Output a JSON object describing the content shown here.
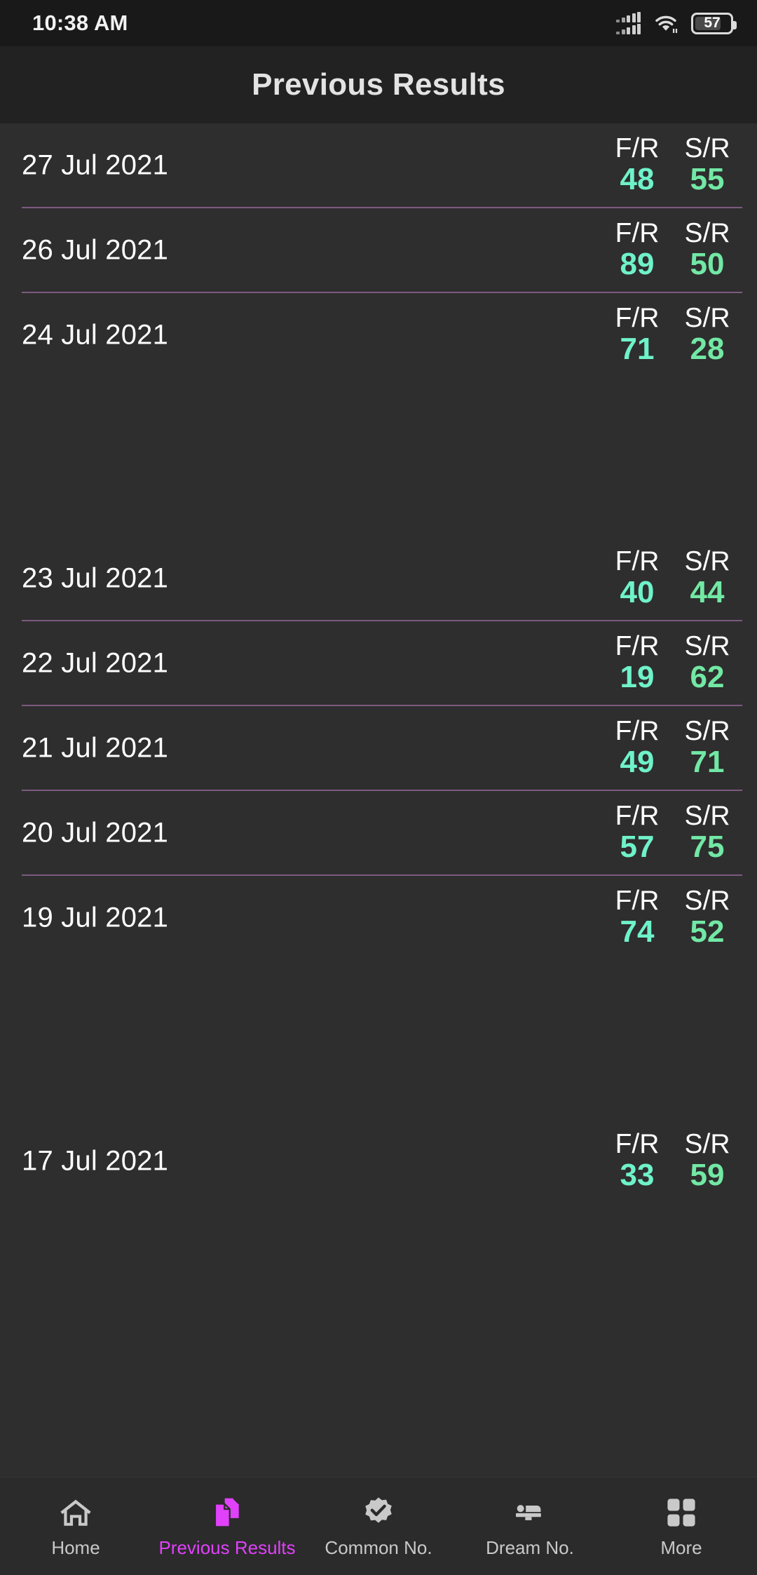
{
  "status_bar": {
    "time": "10:38 AM",
    "battery_level": "57",
    "signal_icon": "signal-bars-icon",
    "wifi_icon": "wifi-icon",
    "battery_icon": "battery-icon"
  },
  "app_bar": {
    "title": "Previous Results"
  },
  "list": {
    "column_labels": {
      "first": "F/R",
      "second": "S/R"
    },
    "rows": [
      {
        "date": "27 Jul 2021",
        "fr": "48",
        "sr": "55",
        "divider": true,
        "gap_after": false
      },
      {
        "date": "26 Jul 2021",
        "fr": "89",
        "sr": "50",
        "divider": true,
        "gap_after": false
      },
      {
        "date": "24 Jul 2021",
        "fr": "71",
        "sr": "28",
        "divider": false,
        "gap_after": true
      },
      {
        "date": "23 Jul 2021",
        "fr": "40",
        "sr": "44",
        "divider": true,
        "gap_after": false
      },
      {
        "date": "22 Jul 2021",
        "fr": "19",
        "sr": "62",
        "divider": true,
        "gap_after": false
      },
      {
        "date": "21 Jul 2021",
        "fr": "49",
        "sr": "71",
        "divider": true,
        "gap_after": false
      },
      {
        "date": "20 Jul 2021",
        "fr": "57",
        "sr": "75",
        "divider": true,
        "gap_after": false
      },
      {
        "date": "19 Jul 2021",
        "fr": "74",
        "sr": "52",
        "divider": false,
        "gap_after": true
      },
      {
        "date": "17 Jul 2021",
        "fr": "33",
        "sr": "59",
        "divider": false,
        "gap_after": false
      }
    ]
  },
  "bottom_nav": {
    "items": [
      {
        "label": "Home",
        "icon": "home-icon",
        "active": false
      },
      {
        "label": "Previous Results",
        "icon": "documents-icon",
        "active": true
      },
      {
        "label": "Common No.",
        "icon": "verified-check-icon",
        "active": false
      },
      {
        "label": "Dream No.",
        "icon": "bed-icon",
        "active": false
      },
      {
        "label": "More",
        "icon": "grid-icon",
        "active": false
      }
    ]
  },
  "colors": {
    "background": "#2e2e2e",
    "appbar": "#222222",
    "statusbar": "#191919",
    "divider": "#7c5a80",
    "fr_value": "#6ff2c9",
    "sr_value": "#72e8a5",
    "accent": "#e141fb",
    "nav_inactive": "#c9c9c9"
  }
}
